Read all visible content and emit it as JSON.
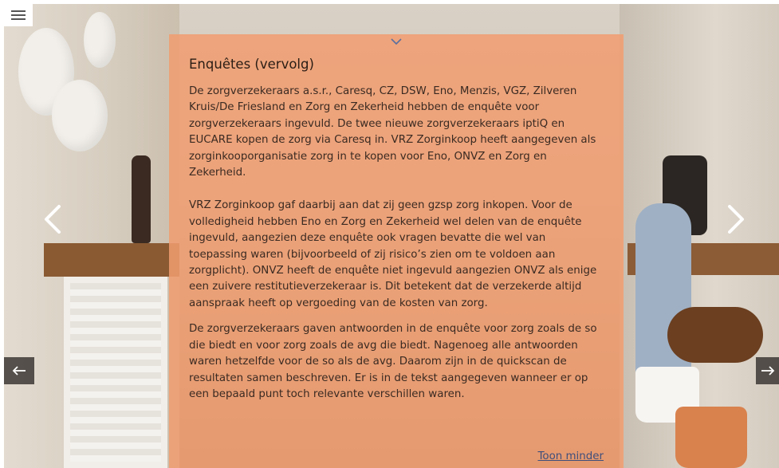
{
  "panel": {
    "title": "Enquêtes (vervolg)",
    "paragraphs": [
      "De zorgverzekeraars a.s.r., Caresq, CZ, DSW, Eno, Menzis, VGZ, Zilveren Kruis/De Friesland en Zorg en Zekerheid hebben de enquête voor zorgverzekeraars ingevuld. De twee nieuwe zorgverzekeraars iptiQ en EUCARE kopen de zorg via Caresq in. VRZ Zorginkoop heeft aangegeven als zorginkooporganisatie zorg in te kopen voor Eno, ONVZ en Zorg en Zekerheid.",
      "VRZ Zorginkoop gaf daarbij aan dat zij geen gzsp zorg inkopen. Voor de volledigheid hebben Eno en Zorg en Zekerheid wel delen van de enquête ingevuld, aangezien deze enquête ook vragen bevatte die wel van toepassing waren (bijvoorbeeld of zij risico’s zien om te voldoen aan zorgplicht). ONVZ heeft de enquête niet ingevuld aangezien ONVZ als enige een zuivere restitutieverzekeraar is. Dit betekent dat de verzekerde altijd aanspraak heeft op vergoeding van de kosten van zorg.",
      "De zorgverzekeraars gaven antwoorden in de enquête voor zorg zoals de so die biedt en voor zorg zoals de avg die biedt. Nagenoeg alle antwoorden waren hetzelfde voor de so als de avg. Daarom zijn in de quickscan de resultaten samen beschreven. Er is in de tekst aangegeven wanneer er op een bepaald punt toch relevante verschillen waren."
    ],
    "show_less_link": "Toon minder"
  },
  "icons": {
    "menu": "hamburger-menu-icon",
    "collapse": "chevron-down-icon",
    "prev_slide": "chevron-left-icon",
    "next_slide": "chevron-right-icon",
    "prev_page": "arrow-left-icon",
    "next_page": "arrow-right-icon"
  },
  "colors": {
    "panel_overlay": "#f19d70",
    "text": "#3a2a22",
    "link": "#3e4e7c",
    "chevron": "#5a6fa0"
  }
}
